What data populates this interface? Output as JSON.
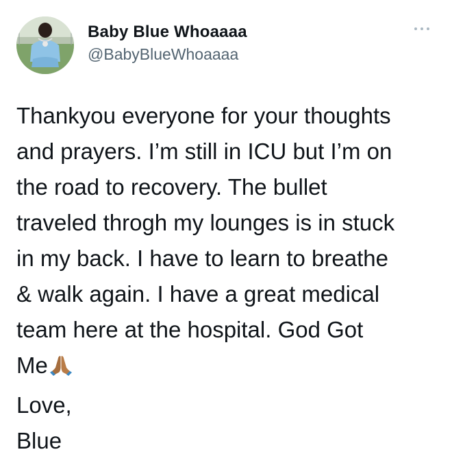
{
  "author": {
    "display_name": "Baby Blue Whoaaaa",
    "handle": "@BabyBlueWhoaaaa"
  },
  "tweet": {
    "lines": [
      "Thankyou everyone for your thoughts",
      "and prayers. I’m still in ICU but I’m on",
      "the road to recovery. The bullet",
      "traveled throgh my lounges is in stuck",
      "in my back. I have to learn to breathe",
      "& walk again. I have a great medical",
      "team here at the hospital. God Got",
      "Me",
      "Love,",
      "Blue"
    ],
    "emoji": "folded-hands"
  },
  "icons": {
    "more": "more-horizontal-icon",
    "emoji": "folded-hands-icon"
  },
  "colors": {
    "text": "#0f1419",
    "secondary_text": "#536471",
    "more_dots": "#aab8c2"
  }
}
